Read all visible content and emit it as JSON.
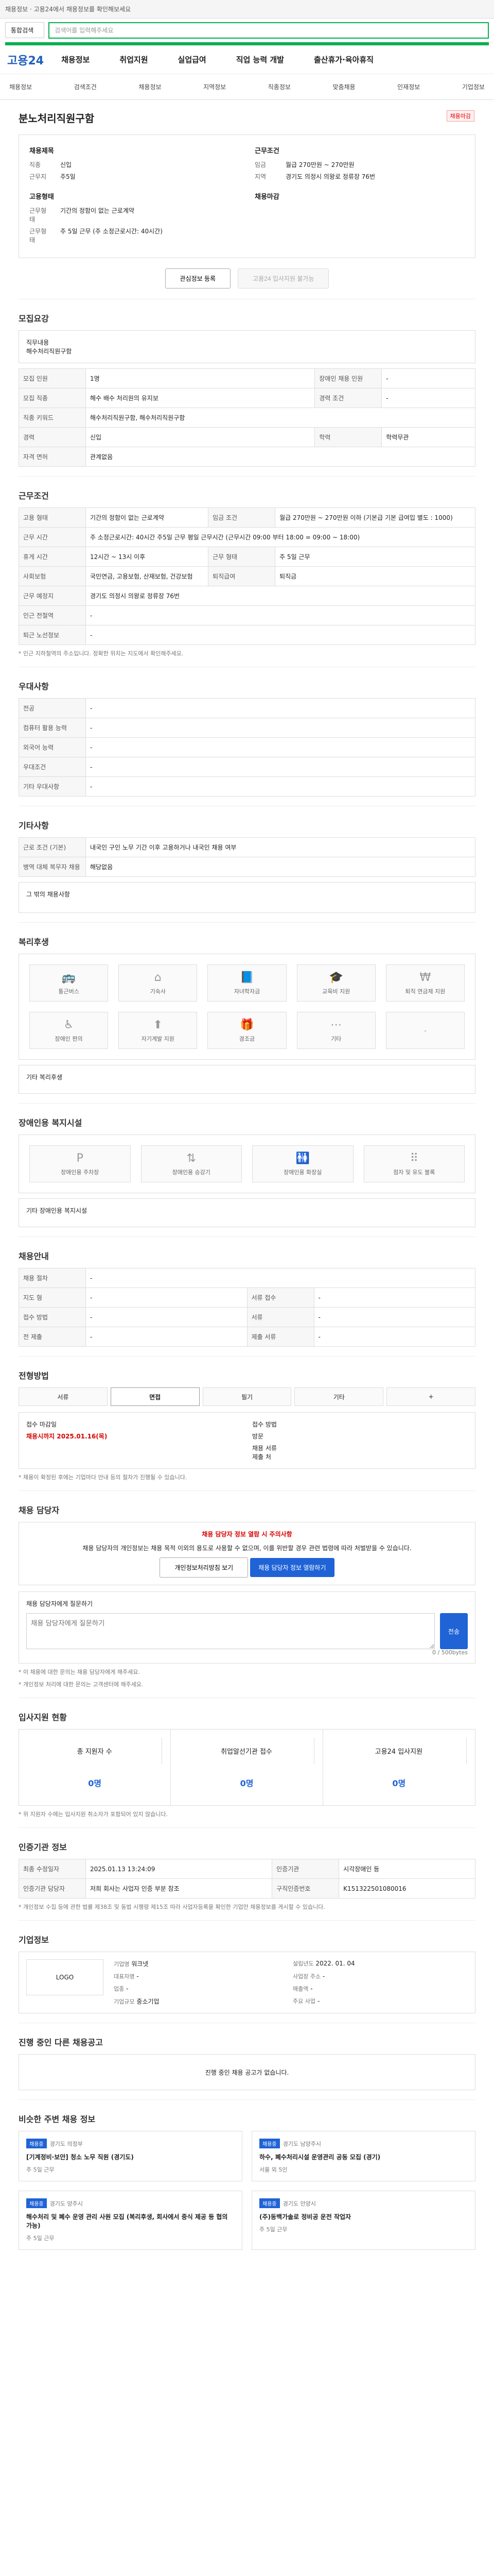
{
  "top": "채용정보 · 고용24에서 채용정보를 확인해보세요",
  "search": {
    "dropdown": "통합검색",
    "placeholder": "검색어를 입력해주세요"
  },
  "header": {
    "logo": "고용24",
    "nav": [
      "채용정보",
      "취업지원",
      "실업급여",
      "직업 능력 개발",
      "출산휴가·육아휴직"
    ]
  },
  "subnav": [
    "채용정보",
    "검색조건",
    "채용정보",
    "지역정보",
    "직종정보",
    "맞춤채용",
    "인재정보",
    "기업정보"
  ],
  "job": {
    "company": "분노처리직원구함",
    "badge": "채용마감",
    "left_title": "채용제목",
    "left_items": [
      [
        "직종",
        "신입"
      ],
      [
        "근무지",
        "주5일"
      ]
    ],
    "right_title": "근무조건",
    "right_items": [
      [
        "임금",
        "월급 270만원 ~ 270만원"
      ],
      [
        "지역",
        "경기도 의정시 의왕로 정류장 76번"
      ]
    ],
    "left_title2": "고용형태",
    "left_items2": [
      [
        "근무형태",
        "기간의 정함이 없는 근로계약"
      ],
      [
        "근무형태",
        "주 5일 근무 (주 소정근로시간: 40시간)"
      ]
    ],
    "right_title2": "채용마감"
  },
  "actions": {
    "save": "관심정보 등록",
    "apply": "고용24 입사지원 불가능"
  },
  "sections": {
    "recruit": {
      "title": "모집요강",
      "field_label": "직무내용",
      "field_value": "해수처리직원구함",
      "rows": [
        [
          "모집 인원",
          "1명",
          "장애인 채용 인원",
          "-"
        ],
        [
          "모집 직종",
          "해수 배수 처리원의 유지보",
          "경력 조건",
          "-"
        ],
        [
          "직종 키워드",
          "해수처리직원구함, 해수처리직원구함",
          "",
          ""
        ],
        [
          "경력",
          "신입",
          "학력",
          "학력무관"
        ],
        [
          "자격 면허",
          "관계없음",
          "",
          ""
        ]
      ]
    },
    "condition": {
      "title": "근무조건",
      "rows": [
        [
          "고용 형태",
          "기간의 정함이 없는 근로계약",
          "임금 조건",
          "월급 270만원 ~ 270만원 이하\n(기본급 기본 급여입 별도 : 1000)"
        ],
        [
          "근무 시간",
          "주 소정근로시간: 40시간\n주5일 근무\n평일 근무시간\n(근무시간 09:00 부터 18:00 = 09:00 ~ 18:00)",
          ""
        ],
        [
          "휴게 시간",
          "12시간 ~ 13시 이후",
          "근무 형태",
          "주 5일 근무"
        ],
        [
          "사회보험",
          "국민연금, 고용보험, 산재보험, 건강보험",
          "퇴직급여",
          "퇴직금"
        ],
        [
          "근무 예정지",
          "경기도 의정시 의왕로 정류장 76번",
          "",
          ""
        ],
        [
          "인근 전철역",
          "-",
          "",
          ""
        ],
        [
          "퇴근 노선정보",
          "-",
          "",
          ""
        ]
      ],
      "note": "* 인근 지하철역의 주소입니다. 정확한 위치는 지도에서 확인해주세요."
    },
    "pref": {
      "title": "우대사항",
      "rows": [
        [
          "전공",
          "-"
        ],
        [
          "컴퓨터 활용 능력",
          "-"
        ],
        [
          "외국어 능력",
          "-"
        ],
        [
          "우대조건",
          "-"
        ],
        [
          "기타 우대사항",
          "-"
        ]
      ]
    },
    "other": {
      "title": "기타사항",
      "rows": [
        [
          "근로 조건 (기본)",
          "내국인 구인 노무 기간 이후 고용하거나 내국인 채용 여부"
        ],
        [
          "병역 대체 복무자 채용",
          "해당없음"
        ]
      ],
      "extra": "그 밖의 채용사항"
    },
    "welfare": {
      "title": "복리후생",
      "items": [
        "통근버스",
        "기숙사",
        "자녀학자금",
        "교육비 지원",
        "퇴직 연금제 지원",
        "장애인 편의",
        "자기계발 지원",
        "경조금",
        "기타",
        "-"
      ],
      "extra": "기타 복리후생"
    },
    "disabled": {
      "title": "장애인용 복지시설",
      "items": [
        "장애인용 주차장",
        "장애인용 승강기",
        "장애인용 화장실",
        "점자 및 유도 블록"
      ],
      "extra": "기타 장애인용 복지시설"
    },
    "apply": {
      "title": "채용안내",
      "rows": [
        [
          "채용 절차",
          "-"
        ],
        [
          "지도 형",
          "-",
          "서류 접수",
          "-"
        ],
        [
          "접수 방법",
          "-",
          "서류",
          "-"
        ],
        [
          "전 제출",
          "-",
          "제출 서류",
          "-"
        ]
      ]
    },
    "progress": {
      "title": "전형방법",
      "tabs": [
        "서류",
        "면접",
        "필기",
        "기타",
        "+"
      ],
      "info_left": "접수 마감일",
      "info_right": "접수 방법",
      "deadline": "채용시까지 2025.01.16(목)",
      "method": "방문",
      "contact": "채용 서류\n제출 처",
      "note": "* 채용이 확정된 후에는 기업마다 안내 등의 절차가 진행될 수 있습니다."
    },
    "person": {
      "title": "채용 담당자",
      "warn": "채용 담당자 정보 열람 시 주의사항",
      "text": "채용 담당자의 개인정보는 채용 목적 이외의 용도로 사용할 수 없으며, 이를 위반할 경우 관련 법령에 따라 처벌받을 수 있습니다.",
      "btn1": "개인정보처리방침 보기",
      "btn2": "채용 담당자 정보 열람하기",
      "ask": "채용 담당자에게 질문하기",
      "placeholder": "채용 담당자에게 질문하기",
      "submit": "전송",
      "counter": "0 / 500bytes",
      "notes": [
        "* 이 채용에 대한 문의는 채용 담당자에게 해주세요.",
        "* 개인정보 처리에 대한 문의는 고객센터에 해주세요."
      ]
    },
    "stats": {
      "title": "입사지원 현황",
      "cards": [
        [
          "총 지원자 수",
          "0명"
        ],
        [
          "취업알선기관 접수",
          "0명"
        ],
        [
          "고용24 입사지원",
          "0명"
        ]
      ],
      "note": "* 위 지원자 수에는 입사지원 취소자가 포함되어 있지 않습니다."
    },
    "auth": {
      "title": "인증기관 정보",
      "btn": "기업인증정보 보기",
      "rows": [
        [
          "최종 수정일자",
          "2025.01.13 13:24:09",
          "인증기관",
          "시각장애인 등"
        ],
        [
          "인증기관 담당자",
          "저희 회사는 사업자 인증 부분 참조",
          "구직인증번호",
          "K151322501080016"
        ]
      ],
      "note": "* 개인정보 수집 등에 관한 법률 제38조 및 동법 시행령 제15조 따라 사업자등록을 확인한 기업만 채용정보를 게시할 수 있습니다."
    },
    "company": {
      "title": "기업정보",
      "btn": "기업정보 더보기",
      "logo": "LOGO",
      "left": [
        [
          "기업명",
          "워크넷"
        ],
        [
          "대표자명",
          "-"
        ],
        [
          "업종",
          "-"
        ],
        [
          "기업규모",
          "중소기업"
        ]
      ],
      "right": [
        [
          "설립년도",
          "2022. 01. 04"
        ],
        [
          "사업장 주소",
          "-"
        ],
        [
          "매출액",
          "-"
        ],
        [
          "주요 사업",
          "-"
        ]
      ],
      "buttons": [
        "관심기업",
        "문의하기"
      ]
    },
    "other_jobs": {
      "title": "진행 중인 다른 채용공고",
      "empty": "진행 중인 채용 공고가 없습니다."
    },
    "similar": {
      "title": "비슷한 주변 채용 정보",
      "more": "더보기",
      "cards": [
        [
          "채용중",
          "경기도 의정부",
          "[기계정비·보안] 청소 노무 직원 (경기도)",
          "주 5일 근무"
        ],
        [
          "채용중",
          "경기도 남양주시",
          "하수, 폐수처리시설 운영관리 공동 모집 (경기)",
          "서울 외 5인"
        ],
        [
          "채용중",
          "경기도 양주시",
          "해수처리 및 폐수 운영 관리 사원 모집 (복리후생, 회사에서 중식 제공 등 협의 가능)",
          "주 5일 근무"
        ],
        [
          "채용중",
          "경기도 안양시",
          "(주)동백가솔로 정비공 운전 작업자",
          "주 5일 근무"
        ]
      ]
    }
  }
}
